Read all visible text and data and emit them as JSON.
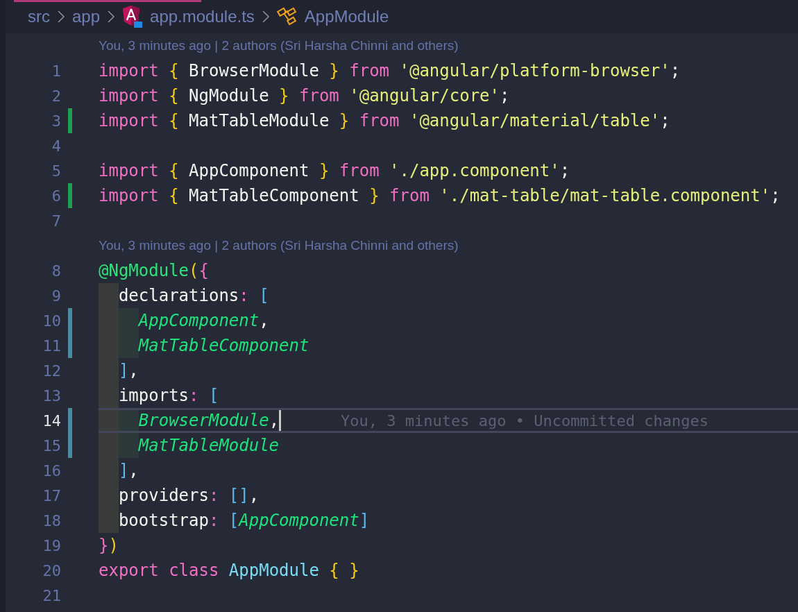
{
  "breadcrumb": [
    {
      "kind": "folder",
      "label": "src"
    },
    {
      "kind": "folder",
      "label": "app"
    },
    {
      "kind": "file",
      "label": "app.module.ts"
    },
    {
      "kind": "symbol",
      "label": "AppModule"
    }
  ],
  "lines": [
    {
      "kind": "codelens",
      "text": "You, 3 minutes ago | 2 authors (Sri Harsha Chinni and others)"
    },
    {
      "kind": "code",
      "number": "1",
      "added": false,
      "modified": false,
      "current": false,
      "tokens": [
        {
          "text": "import ",
          "kind": "keyword"
        },
        {
          "text": "{",
          "kind": "brace"
        },
        {
          "text": " BrowserModule ",
          "kind": "plain"
        },
        {
          "text": "} ",
          "kind": "brace"
        },
        {
          "text": "from ",
          "kind": "keyword"
        },
        {
          "text": "'@angular/platform-browser'",
          "kind": "string"
        },
        {
          "text": ";",
          "kind": "plain"
        }
      ]
    },
    {
      "kind": "code",
      "number": "2",
      "added": false,
      "modified": false,
      "current": false,
      "tokens": [
        {
          "text": "import ",
          "kind": "keyword"
        },
        {
          "text": "{",
          "kind": "brace"
        },
        {
          "text": " NgModule ",
          "kind": "plain"
        },
        {
          "text": "} ",
          "kind": "brace"
        },
        {
          "text": "from ",
          "kind": "keyword"
        },
        {
          "text": "'@angular/core'",
          "kind": "string"
        },
        {
          "text": ";",
          "kind": "plain"
        }
      ]
    },
    {
      "kind": "code",
      "number": "3",
      "added": true,
      "modified": false,
      "current": false,
      "tokens": [
        {
          "text": "import ",
          "kind": "keyword"
        },
        {
          "text": "{",
          "kind": "brace"
        },
        {
          "text": " MatTableModule ",
          "kind": "plain"
        },
        {
          "text": "} ",
          "kind": "brace"
        },
        {
          "text": "from ",
          "kind": "keyword"
        },
        {
          "text": "'@angular/material/table'",
          "kind": "string"
        },
        {
          "text": ";",
          "kind": "plain"
        }
      ]
    },
    {
      "kind": "code",
      "number": "4",
      "added": false,
      "modified": false,
      "current": false
    },
    {
      "kind": "code",
      "number": "5",
      "added": false,
      "modified": false,
      "current": false,
      "tokens": [
        {
          "text": "import ",
          "kind": "keyword"
        },
        {
          "text": "{",
          "kind": "brace"
        },
        {
          "text": " AppComponent ",
          "kind": "plain"
        },
        {
          "text": "} ",
          "kind": "brace"
        },
        {
          "text": "from ",
          "kind": "keyword"
        },
        {
          "text": "'./app.component'",
          "kind": "string"
        },
        {
          "text": ";",
          "kind": "plain"
        }
      ]
    },
    {
      "kind": "code",
      "number": "6",
      "added": true,
      "modified": false,
      "current": false,
      "tokens": [
        {
          "text": "import ",
          "kind": "keyword"
        },
        {
          "text": "{",
          "kind": "brace"
        },
        {
          "text": " MatTableComponent ",
          "kind": "plain"
        },
        {
          "text": "} ",
          "kind": "brace"
        },
        {
          "text": "from ",
          "kind": "keyword"
        },
        {
          "text": "'./mat-table/mat-table.component'",
          "kind": "string"
        },
        {
          "text": ";",
          "kind": "plain"
        }
      ]
    },
    {
      "kind": "code",
      "number": "7",
      "added": false,
      "modified": false,
      "current": false
    },
    {
      "kind": "codelens",
      "text": "You, 3 minutes ago | 2 authors (Sri Harsha Chinni and others)"
    },
    {
      "kind": "code",
      "number": "8",
      "added": false,
      "modified": false,
      "current": false,
      "tokens": [
        {
          "text": "@NgModule",
          "kind": "decorator"
        },
        {
          "text": "(",
          "kind": "brace"
        },
        {
          "text": "{",
          "kind": "keyword"
        }
      ]
    },
    {
      "kind": "code",
      "number": "9",
      "added": false,
      "modified": false,
      "current": false,
      "tokens": [
        {
          "kind": "indent"
        },
        {
          "text": "declarations",
          "kind": "plain"
        },
        {
          "text": ": ",
          "kind": "keyword"
        },
        {
          "text": "[",
          "kind": "bracket"
        }
      ]
    },
    {
      "kind": "code",
      "number": "10",
      "added": false,
      "modified": true,
      "current": false,
      "tokens": [
        {
          "kind": "indent"
        },
        {
          "kind": "indent"
        },
        {
          "text": "AppComponent",
          "kind": "type"
        },
        {
          "text": ",",
          "kind": "plain"
        }
      ]
    },
    {
      "kind": "code",
      "number": "11",
      "added": false,
      "modified": true,
      "current": false,
      "tokens": [
        {
          "kind": "indent"
        },
        {
          "kind": "indent"
        },
        {
          "text": "MatTableComponent",
          "kind": "type"
        }
      ]
    },
    {
      "kind": "code",
      "number": "12",
      "added": false,
      "modified": false,
      "current": false,
      "tokens": [
        {
          "kind": "indent"
        },
        {
          "text": "]",
          "kind": "bracket"
        },
        {
          "text": ",",
          "kind": "plain"
        }
      ]
    },
    {
      "kind": "code",
      "number": "13",
      "added": false,
      "modified": false,
      "current": false,
      "tokens": [
        {
          "kind": "indent"
        },
        {
          "text": "imports",
          "kind": "plain"
        },
        {
          "text": ": ",
          "kind": "keyword"
        },
        {
          "text": "[",
          "kind": "bracket"
        }
      ]
    },
    {
      "kind": "code",
      "number": "14",
      "added": false,
      "modified": true,
      "current": true,
      "blame": "You, 3 minutes ago • Uncommitted changes",
      "tokens": [
        {
          "kind": "indent"
        },
        {
          "kind": "indent"
        },
        {
          "text": "BrowserModule",
          "kind": "type"
        },
        {
          "text": ",",
          "kind": "plain"
        }
      ]
    },
    {
      "kind": "code",
      "number": "15",
      "added": false,
      "modified": true,
      "current": false,
      "tokens": [
        {
          "kind": "indent"
        },
        {
          "kind": "indent"
        },
        {
          "text": "MatTableModule",
          "kind": "type"
        }
      ]
    },
    {
      "kind": "code",
      "number": "16",
      "added": false,
      "modified": false,
      "current": false,
      "tokens": [
        {
          "kind": "indent"
        },
        {
          "text": "]",
          "kind": "bracket"
        },
        {
          "text": ",",
          "kind": "plain"
        }
      ]
    },
    {
      "kind": "code",
      "number": "17",
      "added": false,
      "modified": false,
      "current": false,
      "tokens": [
        {
          "kind": "indent"
        },
        {
          "text": "providers",
          "kind": "plain"
        },
        {
          "text": ": ",
          "kind": "keyword"
        },
        {
          "text": "[]",
          "kind": "bracket"
        },
        {
          "text": ",",
          "kind": "plain"
        }
      ]
    },
    {
      "kind": "code",
      "number": "18",
      "added": false,
      "modified": false,
      "current": false,
      "tokens": [
        {
          "kind": "indent"
        },
        {
          "text": "bootstrap",
          "kind": "plain"
        },
        {
          "text": ": ",
          "kind": "keyword"
        },
        {
          "text": "[",
          "kind": "bracket"
        },
        {
          "text": "AppComponent",
          "kind": "type"
        },
        {
          "text": "]",
          "kind": "bracket"
        }
      ]
    },
    {
      "kind": "code",
      "number": "19",
      "added": false,
      "modified": false,
      "current": false,
      "tokens": [
        {
          "text": "}",
          "kind": "keyword"
        },
        {
          "text": ")",
          "kind": "brace"
        }
      ]
    },
    {
      "kind": "code",
      "number": "20",
      "added": false,
      "modified": false,
      "current": false,
      "tokens": [
        {
          "text": "export ",
          "kind": "keyword"
        },
        {
          "text": "class ",
          "kind": "keyword"
        },
        {
          "text": "AppModule ",
          "kind": "class"
        },
        {
          "text": "{ }",
          "kind": "brace"
        }
      ]
    },
    {
      "kind": "code",
      "number": "21",
      "added": false,
      "modified": false,
      "current": false
    }
  ]
}
